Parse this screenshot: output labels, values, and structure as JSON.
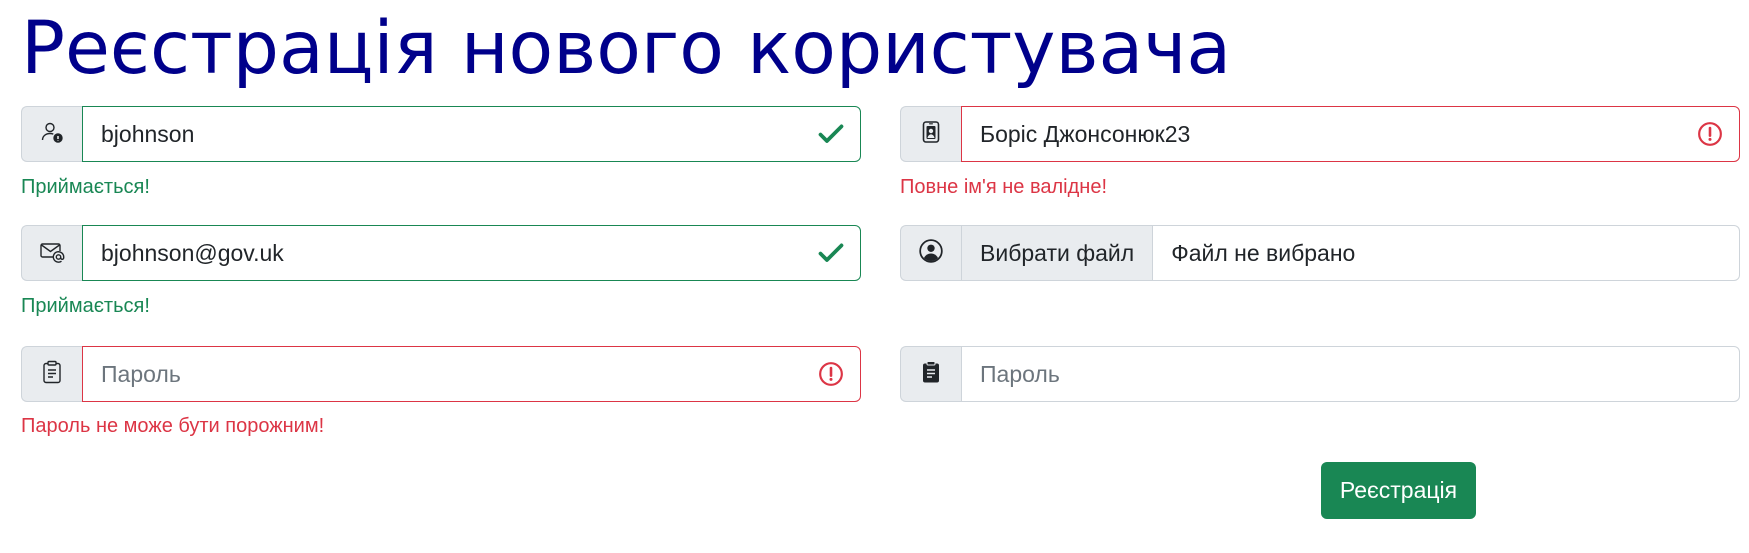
{
  "page": {
    "title": "Реєстрація нового користувача"
  },
  "form": {
    "username": {
      "value": "bjohnson",
      "icon": "person-badge-icon",
      "status": "valid",
      "feedback": "Приймається!"
    },
    "fullname": {
      "value": "Боріс Джонсонюк23",
      "icon": "id-card-icon",
      "status": "invalid",
      "feedback": "Повне ім'я не валідне!"
    },
    "email": {
      "value": "bjohnson@gov.uk",
      "icon": "envelope-at-icon",
      "status": "valid",
      "feedback": "Приймається!"
    },
    "avatar": {
      "icon": "person-circle-icon",
      "button_label": "Вибрати файл",
      "file_name": "Файл не вибрано"
    },
    "password": {
      "value": "",
      "placeholder": "Пароль",
      "icon": "clipboard-icon",
      "status": "invalid",
      "feedback": "Пароль не може бути порожним!"
    },
    "password_confirm": {
      "value": "",
      "placeholder": "Пароль",
      "icon": "clipboard-fill-icon"
    },
    "submit_label": "Реєстрація"
  },
  "colors": {
    "title": "#00008b",
    "valid": "#198754",
    "invalid": "#dc3545",
    "addon_bg": "#e9ecef",
    "border": "#ced4da"
  }
}
